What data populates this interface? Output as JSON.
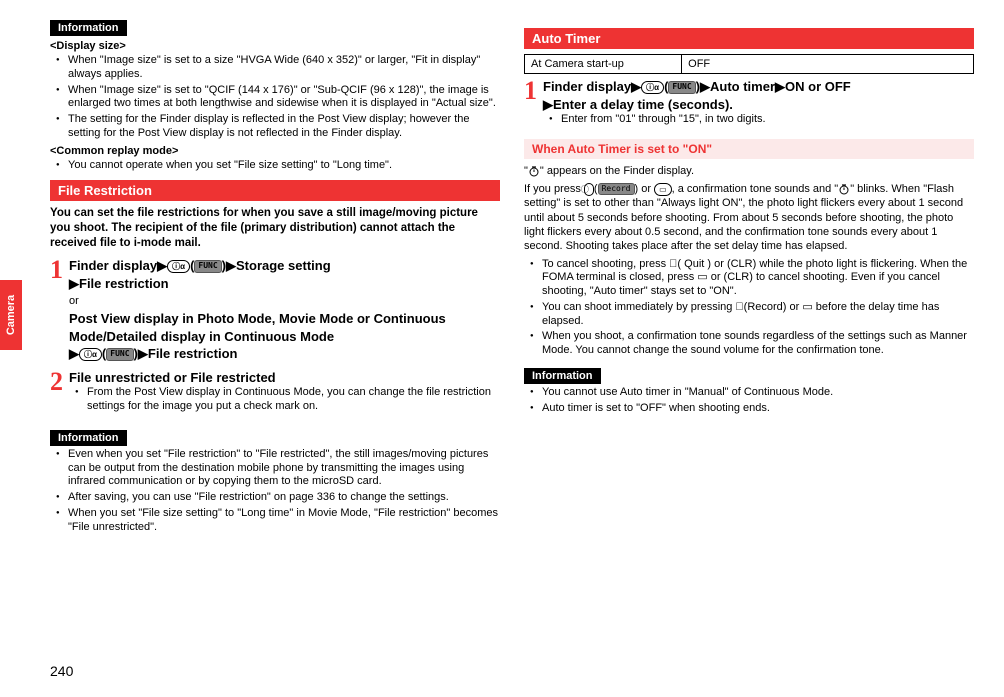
{
  "side_tab": {
    "label": "Camera"
  },
  "page_number": "240",
  "left": {
    "info1": {
      "header": "Information",
      "sub1_title": "<Display size>",
      "sub1_items": [
        "When \"Image size\" is set to a size \"HVGA Wide (640 x 352)\" or larger, \"Fit in display\" always applies.",
        "When \"Image size\" is set to \"QCIF (144 x 176)\" or \"Sub-QCIF (96 x 128)\", the image is enlarged two times at both lengthwise and sidewise when it is displayed in \"Actual size\".",
        "The setting for the Finder display is reflected in the Post View display; however the setting for the Post View display is not reflected in the Finder display."
      ],
      "sub2_title": "<Common replay mode>",
      "sub2_items": [
        "You cannot operate when you set \"File size setting\" to \"Long time\"."
      ]
    },
    "file_restriction": {
      "title": "File Restriction",
      "intro": "You can set the file restrictions for when you save a still image/moving picture you shoot. The recipient of the file (primary distribution) cannot attach the received file to i-mode mail.",
      "step1_a": "Finder display",
      "step1_b": "Storage setting",
      "step1_c": "File restriction",
      "step1_or": "or",
      "step1_d": "Post View display in Photo Mode, Movie Mode or Continuous Mode/Detailed display in Continuous Mode",
      "step1_e": "File restriction",
      "step2_title": "File unrestricted or File restricted",
      "step2_note": "From the Post View display in Continuous Mode, you can change the file restriction settings for the image you put a check mark on."
    },
    "info2": {
      "header": "Information",
      "items": [
        "Even when you set \"File restriction\" to \"File restricted\", the still images/moving pictures can be output from the destination mobile phone by transmitting the images using infrared communication or by copying them to the microSD card.",
        "After saving, you can use \"File restriction\" on page 336 to change the settings.",
        "When you set \"File size setting\" to \"Long time\" in Movie Mode, \"File restriction\" becomes \"File unrestricted\"."
      ]
    }
  },
  "right": {
    "auto_timer": {
      "title": "Auto Timer",
      "table_l": "At Camera start-up",
      "table_r": "OFF",
      "step1_a": "Finder display",
      "step1_b": "Auto timer",
      "step1_c": "ON or OFF",
      "step1_d": "Enter a delay time (seconds).",
      "step1_note": "Enter from \"01\" through \"15\", in two digits."
    },
    "when_on": {
      "title": "When Auto Timer is set to \"ON\"",
      "line0_a": "\"",
      "line0_b": "\" appears on the Finder display.",
      "line1_a": "If you press ",
      "line1_b": " or ",
      "line1_c": ", a confirmation tone sounds and \"",
      "line1_d": "\" blinks. When \"Flash setting\" is set to other than \"Always light ON\", the photo light flickers every about 1 second until about 5 seconds before shooting. From about 5 seconds before shooting, the photo light flickers every about 0.5 second, and the confirmation tone sounds every about 1 second. Shooting takes place after the set delay time has elapsed.",
      "bullets": [
        "To cancel shooting, press ⃝( Quit ) or (CLR) while the photo light is flickering. When the FOMA terminal is closed, press ▭ or (CLR) to cancel shooting. Even if you cancel shooting, \"Auto timer\" stays set to \"ON\".",
        "You can shoot immediately by pressing ⃝(Record) or ▭ before the delay time has elapsed.",
        "When you shoot, a confirmation tone sounds regardless of the settings such as Manner Mode. You cannot change the sound volume for the confirmation tone."
      ]
    },
    "info3": {
      "header": "Information",
      "items": [
        "You cannot use Auto timer in \"Manual\" of Continuous Mode.",
        "Auto timer is set to \"OFF\" when shooting ends."
      ]
    }
  },
  "icons": {
    "func": "FUNC",
    "record": "Record",
    "quit": "Quit",
    "clr": "CLR",
    "ir": "ⓘα",
    "circle": "⃝",
    "rect": "▭"
  }
}
